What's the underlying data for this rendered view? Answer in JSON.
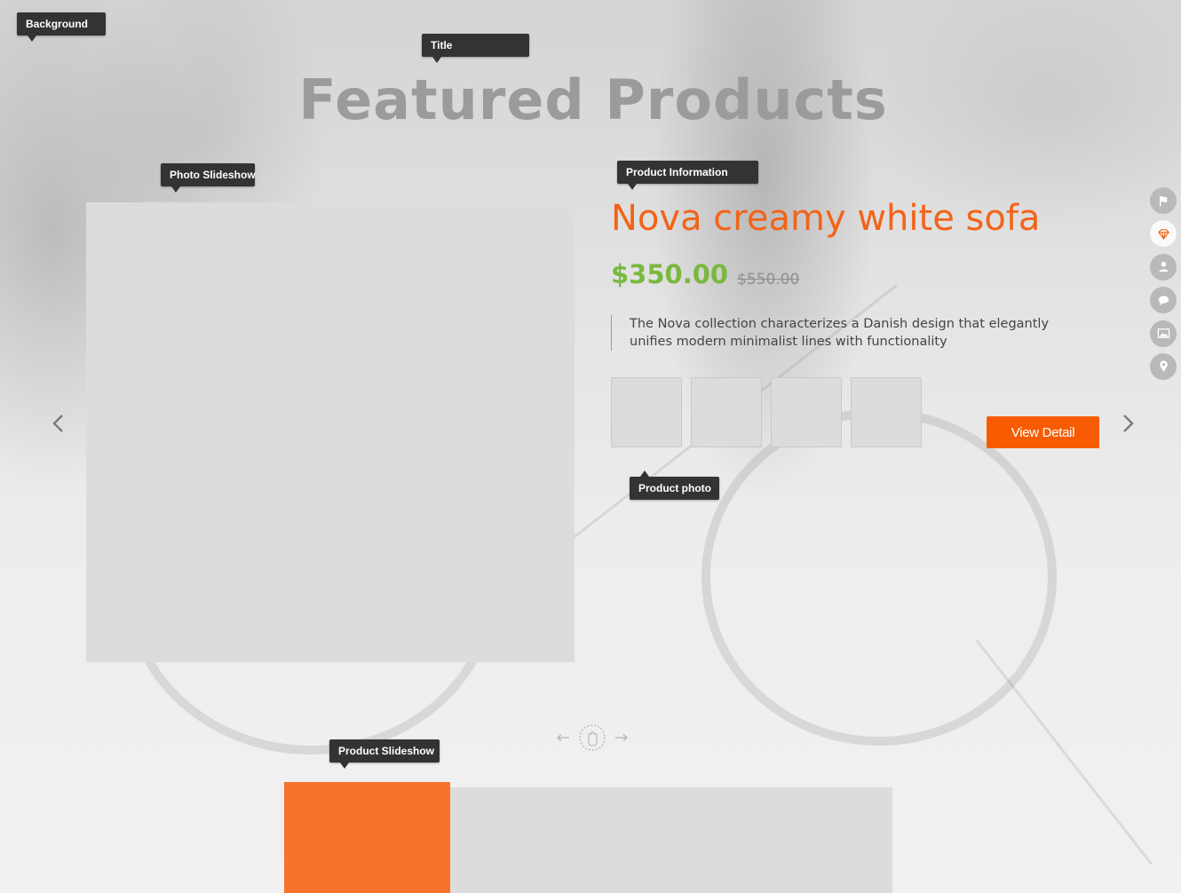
{
  "tooltips": {
    "background": "Background",
    "title": "Title",
    "photo_slideshow": "Photo Slideshow",
    "product_information": "Product Information",
    "product_photo": "Product photo",
    "product_slideshow": "Product Slideshow"
  },
  "page": {
    "title": "Featured Products"
  },
  "product": {
    "name": "Nova creamy white sofa",
    "price": "$350.00",
    "old_price": "$550.00",
    "description": "The Nova collection characterizes a Danish design that elegantly unifies modern minimalist lines with functionality",
    "view_detail_label": "View Detail",
    "thumbnail_count": 4
  },
  "navigation": {
    "prev_icon": "chevron-left-icon",
    "next_icon": "chevron-right-icon",
    "swipe_icon": "hand-swipe-icon"
  },
  "side_nav": {
    "items": [
      "flag-icon",
      "diamond-icon",
      "user-icon",
      "chat-icon",
      "image-icon",
      "map-pin-icon"
    ],
    "active_index": 1
  },
  "colors": {
    "accent_orange": "#f26419",
    "button_orange": "#f75c03",
    "price_green": "#79b93f",
    "title_gray": "#9b9b9b"
  }
}
